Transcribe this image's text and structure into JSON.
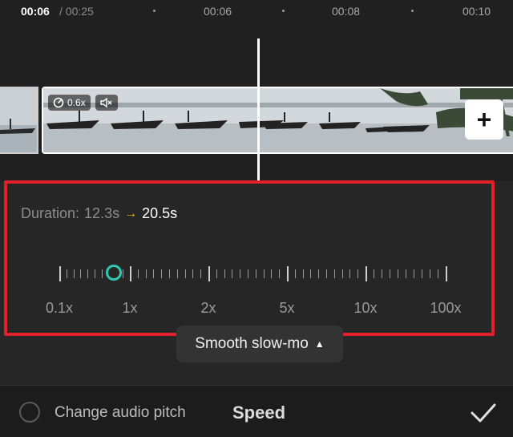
{
  "timebar": {
    "current": "00:06",
    "total": "/ 00:25",
    "marks": [
      "00:06",
      "00:08",
      "00:10"
    ]
  },
  "clip": {
    "speed_badge": "0.6x",
    "speed_icon": "speed-gauge-icon",
    "mute_icon": "speaker-muted-icon",
    "add_label": "+"
  },
  "duration": {
    "label": "Duration:",
    "from": "12.3s",
    "arrow": "→",
    "to": "20.5s"
  },
  "speed": {
    "labels": [
      "0.1x",
      "1x",
      "2x",
      "5x",
      "10x",
      "100x"
    ],
    "current_value": "0.6x"
  },
  "mode_button": {
    "label": "Smooth slow-mo",
    "caret": "▲"
  },
  "bottom": {
    "pitch_label": "Change audio pitch",
    "title": "Speed",
    "confirm_icon": "checkmark-icon"
  },
  "colors": {
    "accent": "#2fc8b4",
    "arrow": "#f2c200",
    "highlight": "#e2202a"
  }
}
